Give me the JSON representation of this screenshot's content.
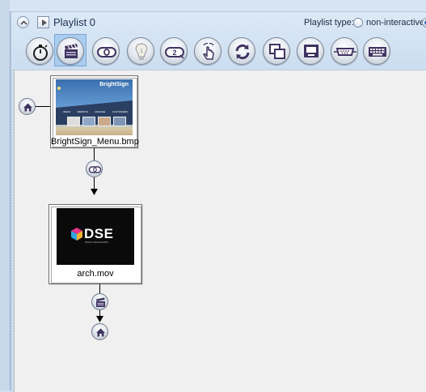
{
  "header": {
    "title": "Playlist 0",
    "type_label": "Playlist type:",
    "option_non_interactive": "non-interactive"
  },
  "toolbar": {
    "tools": [
      {
        "icon": "stopwatch-icon",
        "name": "timeout-event"
      },
      {
        "icon": "clapperboard-icon",
        "name": "video-end-event",
        "selected": true
      },
      {
        "icon": "zero-button-icon",
        "name": "bp900-event"
      },
      {
        "icon": "lightbulb-one-icon",
        "name": "gpio-event"
      },
      {
        "icon": "two-button-icon",
        "name": "keyboard-2-event"
      },
      {
        "icon": "touch-hand-icon",
        "name": "touch-event"
      },
      {
        "icon": "refresh-icon",
        "name": "synchronize-event"
      },
      {
        "icon": "zones-icon",
        "name": "zone-message-event"
      },
      {
        "icon": "serial-device-icon",
        "name": "udp-event"
      },
      {
        "icon": "serial-port-icon",
        "name": "serial-event"
      },
      {
        "icon": "keyboard-icon",
        "name": "keyboard-event"
      }
    ]
  },
  "canvas": {
    "states": [
      {
        "label": "BrightSign_Menu.bmp",
        "thumb": "menu-thumbnail",
        "thumb_text": "BrightSign",
        "menu_items": [
          "IDEAS",
          "WEBSITE",
          "MANAGE",
          "CUSTOMERS"
        ]
      },
      {
        "label": "arch.mov",
        "thumb": "video-thumbnail",
        "logo_text": "DSE",
        "logo_sub": "DIGITAL SIGNAGE EXPO"
      }
    ]
  },
  "colors": {
    "panel_bg": "#cddff1",
    "canvas_bg": "#f0f0f0",
    "selected_tool": "#a9cdef",
    "icon_purple": "#3f3360"
  }
}
